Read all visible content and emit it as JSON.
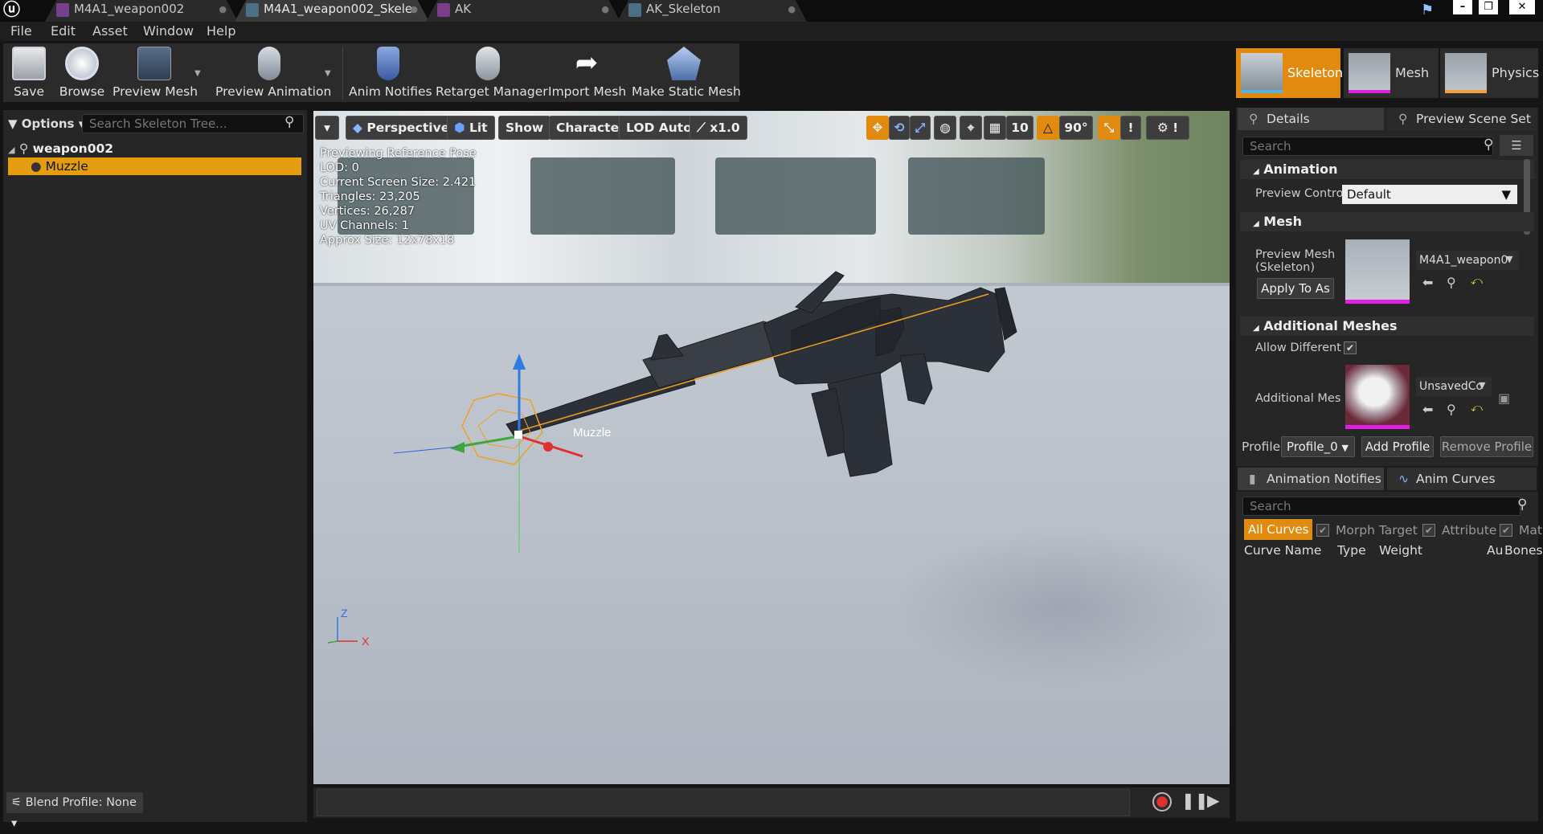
{
  "tabs": [
    {
      "label": "M4A1_weapon002",
      "type": "mesh"
    },
    {
      "label": "M4A1_weapon002_Skele",
      "type": "skeleton",
      "active": true
    },
    {
      "label": "AK",
      "type": "mesh"
    },
    {
      "label": "AK_Skeleton",
      "type": "skeleton"
    }
  ],
  "window_buttons": {
    "minimize": "–",
    "maximize": "❐",
    "close": "✕"
  },
  "menu": [
    "File",
    "Edit",
    "Asset",
    "Window",
    "Help"
  ],
  "toolbar": {
    "save": "Save",
    "browse": "Browse",
    "preview_mesh": "Preview Mesh",
    "preview_animation": "Preview Animation",
    "anim_notifies": "Anim Notifies",
    "retarget_manager": "Retarget Manager",
    "import_mesh": "Import Mesh",
    "make_static_mesh": "Make Static Mesh"
  },
  "modes": {
    "skeleton": "Skeleton",
    "mesh": "Mesh",
    "physics": "Physics"
  },
  "skeleton_tree": {
    "options_label": "Options",
    "search_placeholder": "Search Skeleton Tree...",
    "root": "weapon002",
    "child": "Muzzle",
    "blend_profile": "Blend Profile: None"
  },
  "viewport": {
    "perspective": "Perspective",
    "lit": "Lit",
    "show": "Show",
    "character": "Character",
    "lod": "LOD Auto",
    "speed": "x1.0",
    "grid_value": "10",
    "angle_value": "90°",
    "stats": [
      "Previewing Reference Pose",
      "LOD: 0",
      "Current Screen Size: 2.421",
      "Triangles: 23,205",
      "Vertices: 26,287",
      "UV Channels: 1",
      "Approx Size: 12x78x18"
    ],
    "bone_label": "Muzzle",
    "axis_z": "Z",
    "axis_x": "X"
  },
  "details": {
    "tab_details": "Details",
    "tab_preview": "Preview Scene Set",
    "search_placeholder": "Search",
    "section_animation": "Animation",
    "preview_controller_label": "Preview Contro",
    "preview_controller_value": "Default",
    "section_mesh": "Mesh",
    "preview_mesh_label": "Preview Mesh (Skeleton)",
    "preview_mesh_value": "M4A1_weapon0",
    "apply_button": "Apply To As",
    "section_additional": "Additional Meshes",
    "allow_different_label": "Allow Different",
    "allow_different_checked": true,
    "additional_mesh_label": "Additional Mes",
    "additional_mesh_value": "UnsavedCo",
    "profile_label": "Profile",
    "profile_value": "Profile_0",
    "add_profile": "Add Profile",
    "remove_profile": "Remove Profile"
  },
  "curves": {
    "tab_notifies": "Animation Notifies",
    "tab_curves": "Anim Curves",
    "search_placeholder": "Search",
    "filter_all": "All Curves",
    "filter_morph": "Morph Target",
    "filter_attribute": "Attribute",
    "filter_mat": "Mat",
    "col_name": "Curve Name",
    "col_type": "Type",
    "col_weight": "Weight",
    "col_au": "Au",
    "col_bones": "Bones"
  },
  "colors": {
    "accent": "#e08a10",
    "selection": "#e49d10",
    "panel": "#262626"
  }
}
